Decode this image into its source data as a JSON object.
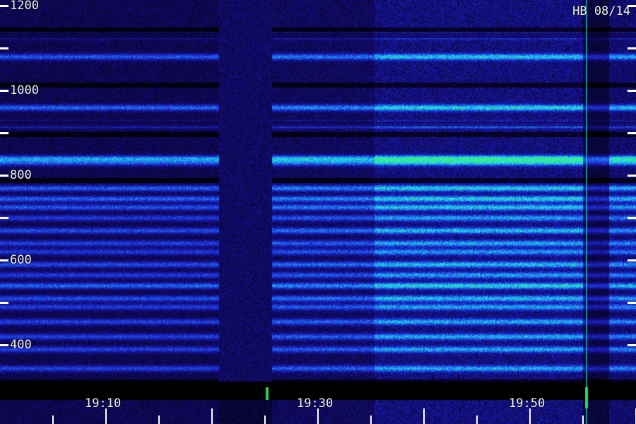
{
  "chart_data": {
    "type": "heatmap",
    "annotation": "HB 08/14",
    "y_range": [
      380,
      1200
    ],
    "y_tick_labels": [
      {
        "value": 1200,
        "text": "1200"
      },
      {
        "value": 1000,
        "text": "1000"
      },
      {
        "value": 800,
        "text": "800"
      },
      {
        "value": 600,
        "text": "600"
      },
      {
        "value": 400,
        "text": "400"
      }
    ],
    "y_minor_ticks": [
      1100,
      900,
      700,
      500
    ],
    "x_range_minutes": [
      19.0,
      19.98
    ],
    "x_tick_labels": [
      {
        "text": "19:10"
      },
      {
        "text": "19:30"
      },
      {
        "text": "19:50"
      }
    ],
    "harmonic_bands": [
      1130,
      1080,
      960,
      920,
      840,
      830,
      770,
      745,
      725,
      700,
      670,
      640,
      620,
      590,
      565,
      540,
      510,
      490,
      455,
      420,
      390,
      345
    ],
    "strongest_band": 840,
    "dropout_segments": [
      "gap near 19:22",
      "gap near 19:55"
    ],
    "colormap": [
      "#000000",
      "#120a6e",
      "#1d2ad8",
      "#1a8cf0",
      "#1ee6e6",
      "#3cf07a"
    ]
  },
  "colors": {
    "background": "#000000",
    "label": "#f2f2f2"
  }
}
